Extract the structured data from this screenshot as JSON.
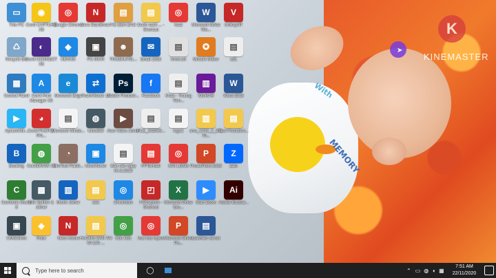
{
  "watermark": {
    "brand": "KINEMASTER",
    "logo_letter": "K"
  },
  "shirt": {
    "text1": "With",
    "text2": "MEMORY"
  },
  "desktop_icons": [
    {
      "label": "This PC",
      "color": "#3d8fd6",
      "glyph": "▭"
    },
    {
      "label": "Corel CAPTURE X8",
      "color": "#f5c518",
      "glyph": "◉"
    },
    {
      "label": "Google Chrome",
      "color": "#e53935",
      "glyph": "◎"
    },
    {
      "label": "Nero StartSmart",
      "color": "#c62828",
      "glyph": "N"
    },
    {
      "label": "YE BEN BAO",
      "color": "#e0a040",
      "glyph": "▤"
    },
    {
      "label": "Danh sach ... - Shortcut",
      "color": "#f2c94c",
      "glyph": "▤"
    },
    {
      "label": "hoai",
      "color": "#e53935",
      "glyph": "◎"
    },
    {
      "label": "Microsoft Office Wo...",
      "color": "#2b5797",
      "glyph": "W"
    },
    {
      "label": "UnikeyNT",
      "color": "#c62828",
      "glyph": "V"
    },
    {
      "label": "Recycle Bin",
      "color": "#7fa7c9",
      "glyph": "♺"
    },
    {
      "label": "Corel CONNECT X8",
      "color": "#4a2a8a",
      "glyph": "◐"
    },
    {
      "label": "KBVMS",
      "color": "#1e88e5",
      "glyph": "◆"
    },
    {
      "label": "PC-INVR",
      "color": "#444",
      "glyph": "▣"
    },
    {
      "label": "TRUBKU751...",
      "color": "#8e6b4f",
      "glyph": "☻"
    },
    {
      "label": "Email 2016",
      "color": "#1565c0",
      "glyph": "✉"
    },
    {
      "label": "hmsi.sel",
      "color": "#e0e0e0",
      "glyph": "▤"
    },
    {
      "label": "Miracle Maker",
      "color": "#e07b1f",
      "glyph": "✪"
    },
    {
      "label": "ud1",
      "color": "#eeeeee",
      "glyph": "▤"
    },
    {
      "label": "Control Panel",
      "color": "#2f7bbf",
      "glyph": "▦"
    },
    {
      "label": "Corel Font Manager X8",
      "color": "#1e88e5",
      "glyph": "A"
    },
    {
      "label": "Microsoft Edge",
      "color": "#1b8ad6",
      "glyph": "e"
    },
    {
      "label": "TeamViewer 14",
      "color": "#0e6fd2",
      "glyph": "⇄"
    },
    {
      "label": "Adobe Photosh...",
      "color": "#001e36",
      "glyph": "Ps"
    },
    {
      "label": "Facebook",
      "color": "#1877f2",
      "glyph": "f"
    },
    {
      "label": "Khan - Truong Tien...",
      "color": "#eeeeee",
      "glyph": "▤"
    },
    {
      "label": "WinRAR",
      "color": "#6a1b9a",
      "glyph": "▥"
    },
    {
      "label": "Word 2016",
      "color": "#2b5797",
      "glyph": "W"
    },
    {
      "label": "ApowerMir...",
      "color": "#29b6f6",
      "glyph": "▶"
    },
    {
      "label": "Corel PHOTO-PAI...",
      "color": "#d32f2f",
      "glyph": "◕"
    },
    {
      "label": "Microsoft Windo...",
      "color": "#f4f4f4",
      "glyph": "▤"
    },
    {
      "label": "UltraISO",
      "color": "#455a64",
      "glyph": "◍"
    },
    {
      "label": "Aion Video Joiner",
      "color": "#6d4c41",
      "glyph": "▶"
    },
    {
      "label": "FILE_202006...",
      "color": "#eeeeee",
      "glyph": "▤"
    },
    {
      "label": "logo1",
      "color": "#f4f4f4",
      "glyph": "▤"
    },
    {
      "label": "sms_CAM_2_20170...",
      "color": "#f2c94c",
      "glyph": "▥"
    },
    {
      "label": "Vice President...",
      "color": "#f2c94c",
      "glyph": "▤"
    },
    {
      "label": "Booking",
      "color": "#1565c0",
      "glyph": "B"
    },
    {
      "label": "CorelDRAW X8",
      "color": "#43a047",
      "glyph": "◍"
    },
    {
      "label": "MiniTool Partiti...",
      "color": "#8d6e63",
      "glyph": "◔"
    },
    {
      "label": "UltraViewer",
      "color": "#1e88e5",
      "glyph": "▣"
    },
    {
      "label": "Báo cáo ngày 04.8.2019",
      "color": "#f4f4f4",
      "glyph": "▤"
    },
    {
      "label": "FPTsHotel",
      "color": "#e53935",
      "glyph": "▤"
    },
    {
      "label": "MAI LONG",
      "color": "#e53935",
      "glyph": "◎"
    },
    {
      "label": "PowerPoint 2016",
      "color": "#d24726",
      "glyph": "P"
    },
    {
      "label": "Zalo",
      "color": "#0068ff",
      "glyph": "Z"
    },
    {
      "label": "Camtasia Studio 8",
      "color": "#2e7d32",
      "glyph": "C"
    },
    {
      "label": "File Splitter & Joiner",
      "color": "#455a64",
      "glyph": "▦"
    },
    {
      "label": "Movie Joiner",
      "color": "#1565c0",
      "glyph": "▥"
    },
    {
      "label": "aaa",
      "color": "#f2c94c",
      "glyph": "▤"
    },
    {
      "label": "Chromium",
      "color": "#1e88e5",
      "glyph": "◎"
    },
    {
      "label": "FSCapture - Shortcut",
      "color": "#c62828",
      "glyph": "◰"
    },
    {
      "label": "Microsoft Office Exc...",
      "color": "#217346",
      "glyph": "X"
    },
    {
      "label": "Start Zoom",
      "color": "#2d8cff",
      "glyph": "▶"
    },
    {
      "label": "Adobe Illustrat...",
      "color": "#330000",
      "glyph": "Ai"
    },
    {
      "label": "CMSClient",
      "color": "#37474f",
      "glyph": "▣"
    },
    {
      "label": "Fotor",
      "color": "#fbc02d",
      "glyph": "◈"
    },
    {
      "label": "Nero Home",
      "color": "#c62828",
      "glyph": "N"
    },
    {
      "label": "HUONG DAN TAI VA CAI ...",
      "color": "#f2c94c",
      "glyph": "▤"
    },
    {
      "label": "Cốc Cốc",
      "color": "#43a047",
      "glyph": "◎"
    },
    {
      "label": "hoc truc tuyen",
      "color": "#e53935",
      "glyph": "◎"
    },
    {
      "label": "Microsoft Office Po...",
      "color": "#d24726",
      "glyph": "P"
    },
    {
      "label": "tuanhien va hoi",
      "color": "#2b5797",
      "glyph": "▤"
    }
  ],
  "taskbar": {
    "search_placeholder": "Type here to search",
    "time": "7:51 AM",
    "date": "22/11/2020"
  }
}
